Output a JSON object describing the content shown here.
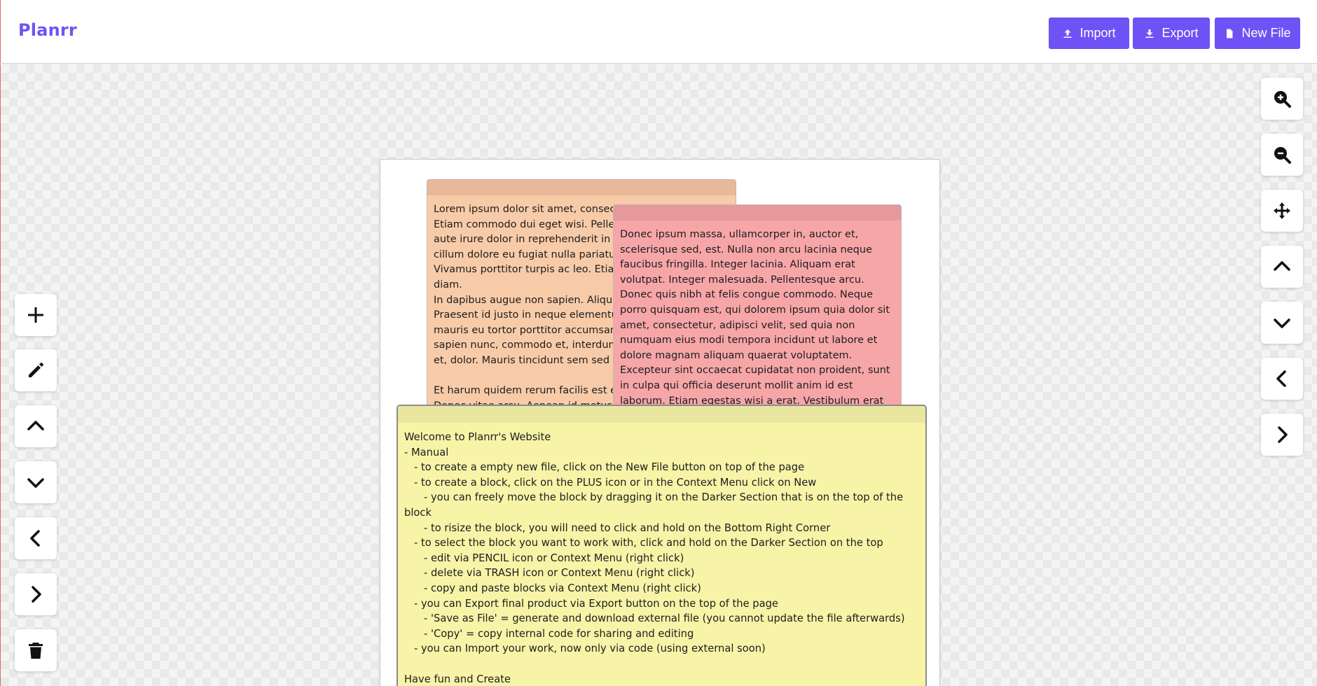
{
  "app": {
    "brand": "Planrr"
  },
  "header": {
    "buttons": [
      {
        "label": "Import",
        "icon": "upload-icon"
      },
      {
        "label": "Export",
        "icon": "download-icon"
      },
      {
        "label": "New File",
        "icon": "file-icon"
      }
    ]
  },
  "colors": {
    "accent": "#6e52f5",
    "note_orange": "#f8cba8",
    "note_red": "#f7a6a8",
    "note_yellow": "#f7f4a8"
  },
  "notes": {
    "orange": "Lorem ipsum dolor sit amet, consectetur adipiscing elit.\nEtiam commodo dui eget wisi. Pellentesque ipsum. Duis\naute irure dolor in reprehenderit in voluptate velit esse\ncillum dolore eu fugiat nulla pariatur. Integer tempor.\nVivamus porttitor turpis ac leo. Etiam dictum tincidunt diam.\nIn dapibus augue non sapien. Aliquam erat volutpat.\nPraesent id justo in neque elementum ultrices. Fusce\nmauris eu tortor porttitor accumsan. Suspendisse nisl.\nsapien nunc, commodo et, interdum suscipit, sollicitudin\net, dolor. Mauris tincidunt sem sed arcu.\n\nEt harum quidem rerum facilis est et expedita distinctio.\nDonec vitae arcu. Aenean id metus id velit ullamcorper\npulvinar. Aenean placerat. Maecenas libero.",
    "red": "Donec ipsum massa, ullamcorper in, auctor et,\nscelerisque sed, est. Nulla non arcu lacinia neque\nfaucibus fringilla. Integer lacinia. Aliquam erat\nvolutpat. Integer malesuada. Pellentesque arcu.\nDonec quis nibh at felis congue commodo. Neque\nporro quisquam est, qui dolorem ipsum quia dolor sit\namet, consectetur, adipisci velit, sed quia non\nnumquam eius modi tempora incidunt ut labore et\ndolore magnam aliquam quaerat voluptatem.\nExcepteur sint occaecat cupidatat non proident, sunt\nin culpa qui officia deserunt mollit anim id est\nlaborum. Etiam egestas wisi a erat. Vestibulum erat\nnulla, ullamcorper nec, rutrum non, nonummy ac, erat.",
    "yellow": "Welcome to Planrr's Website\n- Manual\n   - to create a empty new file, click on the New File button on top of the page\n   - to create a block, click on the PLUS icon or in the Context Menu click on New\n      - you can freely move the block by dragging it on the Darker Section that is on the top of the block\n      - to risize the block, you will need to click and hold on the Bottom Right Corner\n   - to select the block you want to work with, click and hold on the Darker Section on the top\n      - edit via PENCIL icon or Context Menu (right click)\n      - delete via TRASH icon or Context Menu (right click)\n      - copy and paste blocks via Context Menu (right click)\n   - you can Export final product via Export button on the top of the page\n      - 'Save as File' = generate and download external file (you cannot update the file afterwards)\n      - 'Copy' = copy internal code for sharing and editing\n   - you can Import your work, now only via code (using external soon)\n\nHave fun and Create\n- @neostetic (https://neostetic.github.io)"
  },
  "left_tools": [
    "plus-icon",
    "pencil-icon",
    "chevron-up-icon",
    "chevron-down-icon",
    "chevron-left-icon",
    "chevron-right-icon",
    "trash-icon"
  ],
  "right_tools": [
    "zoom-in-icon",
    "zoom-out-icon",
    "move-icon",
    "chevron-up-icon",
    "chevron-down-icon",
    "chevron-left-icon",
    "chevron-right-icon"
  ]
}
